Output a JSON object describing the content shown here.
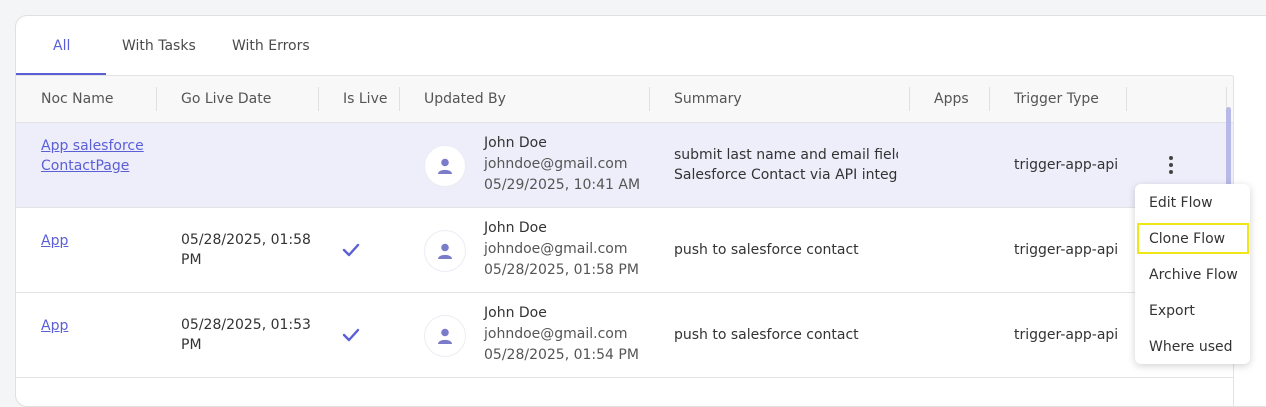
{
  "tabs": [
    {
      "label": "All",
      "active": true
    },
    {
      "label": "With Tasks",
      "active": false
    },
    {
      "label": "With Errors",
      "active": false
    }
  ],
  "columns": {
    "noc_name": "Noc Name",
    "go_live_date": "Go Live Date",
    "is_live": "Is Live",
    "updated_by": "Updated By",
    "summary": "Summary",
    "apps": "Apps",
    "trigger_type": "Trigger Type"
  },
  "rows": [
    {
      "noc_name_line1": "App salesforce",
      "noc_name_line2": "ContactPage",
      "go_live_line1": "",
      "go_live_line2": "",
      "is_live": false,
      "user_name": "John Doe",
      "user_email": "johndoe@gmail.com",
      "updated_at": "05/29/2025, 10:41 AM",
      "summary_line1": "submit last name and email fields",
      "summary_line2": "Salesforce Contact via API integr",
      "trigger_type": "trigger-app-api",
      "selected": true
    },
    {
      "noc_name_line1": "App",
      "noc_name_line2": "",
      "go_live_line1": "05/28/2025, 01:58",
      "go_live_line2": "PM",
      "is_live": true,
      "user_name": "John Doe",
      "user_email": "johndoe@gmail.com",
      "updated_at": "05/28/2025, 01:58 PM",
      "summary_line1": "push to salesforce contact",
      "summary_line2": "",
      "trigger_type": "trigger-app-api",
      "selected": false
    },
    {
      "noc_name_line1": "App",
      "noc_name_line2": "",
      "go_live_line1": "05/28/2025, 01:53",
      "go_live_line2": "PM",
      "is_live": true,
      "user_name": "John Doe",
      "user_email": "johndoe@gmail.com",
      "updated_at": "05/28/2025, 01:54 PM",
      "summary_line1": "push to salesforce contact",
      "summary_line2": "",
      "trigger_type": "trigger-app-api",
      "selected": false
    }
  ],
  "context_menu": {
    "items": [
      "Edit Flow",
      "Clone Flow",
      "Archive Flow",
      "Export",
      "Where used"
    ],
    "highlighted": "Clone Flow"
  },
  "colors": {
    "accent": "#5b5fd6",
    "selected_row": "#eeeefb",
    "highlight_border": "#f0e816"
  }
}
